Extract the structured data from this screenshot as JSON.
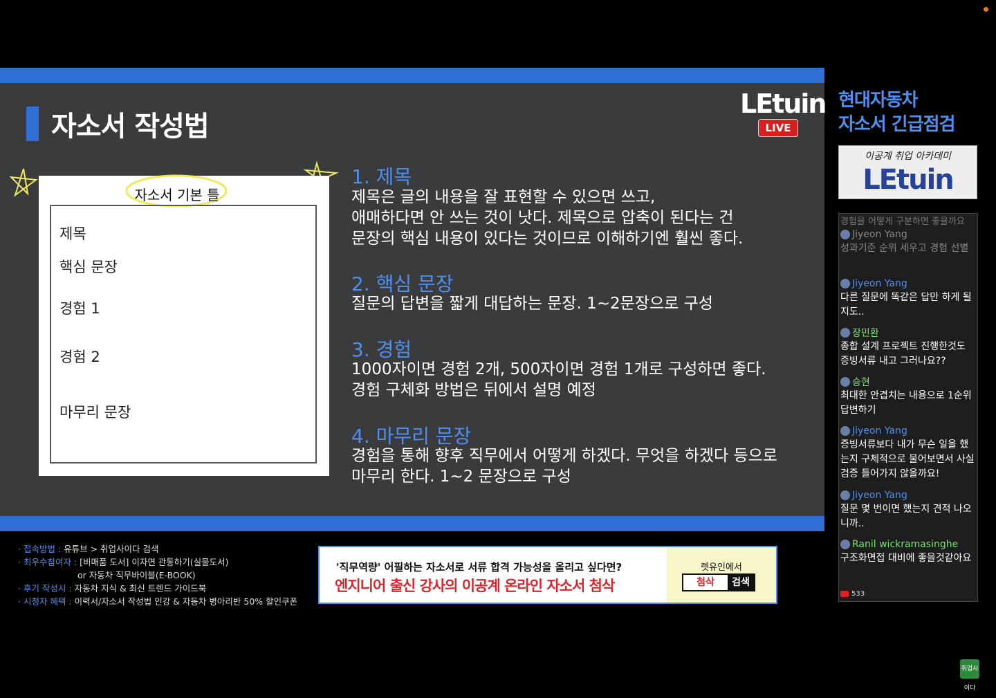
{
  "slide": {
    "title": "자소서 작성법",
    "logo": "LEtuin",
    "live": "LIVE",
    "card_header": "자소서 기본 틀",
    "card_items": [
      "제목",
      "핵심 문장",
      "경험 1",
      "경험 2",
      "마무리 문장"
    ],
    "sections": [
      {
        "head": "1. 제목",
        "lines": [
          "제목은 글의 내용을 잘 표현할 수 있으면 쓰고,",
          "애매하다면 안 쓰는 것이 낫다. 제목으로 압축이 된다는 건",
          "문장의 핵심 내용이 있다는 것이므로 이해하기엔 훨씬 좋다."
        ]
      },
      {
        "head": "2. 핵심 문장",
        "lines": [
          "질문의 답변을 짧게 대답하는 문장. 1~2문장으로 구성"
        ]
      },
      {
        "head": "3. 경험",
        "lines": [
          "1000자이면 경험 2개, 500자이면 경험 1개로 구성하면 좋다.",
          "경험 구체화 방법은 뒤에서 설명 예정"
        ]
      },
      {
        "head": "4. 마무리 문장",
        "lines": [
          "경험을 통해 향후 직무에서 어떻게 하겠다. 무엇을 하겠다 등으로",
          "마무리 한다. 1~2 문장으로 구성"
        ]
      }
    ]
  },
  "info": [
    {
      "label": "· 접속방법 :",
      "text": " 유튜브 > 취업사이다 검색"
    },
    {
      "label": "· 최우수참여자 :",
      "text": " [비매품 도서] 이자면 관통하기(실물도서)"
    },
    {
      "label": "",
      "text": "or 자동차 직무바이블(E-BOOK)"
    },
    {
      "label": "· 후기 작성시 :",
      "text": " 자동차 지식 & 최신 트렌드 가이드북"
    },
    {
      "label": "· 시청자 혜택 :",
      "text": " 이력서/자소서 작성법 인강 & 자동차 병아리반 50% 할인쿠폰"
    }
  ],
  "promo": {
    "sub": "'직무역량' 어필하는 자소서로 서류 합격 가능성을 올리고 싶다면?",
    "main": "엔지니어 출신 강사의 이공계 온라인 자소서 첨삭",
    "label": "렛유인에서",
    "search_value": "첨삭",
    "search_button": "검색"
  },
  "sidebar": {
    "title_line1": "현대자동차",
    "title_line2": "자소서 긴급점검",
    "logo_tag": "이공계 취업 아카데미",
    "logo": "LEtuin",
    "chat_top_faded": "경험을 어떻게 구분하면 좋을까요",
    "messages": [
      {
        "author": "Jiyeon Yang",
        "text": "성과기준 순위 세우고 경험 선별",
        "faded": true,
        "green": false
      },
      {
        "author": "Jiyeon Yang",
        "text": "다른 질문에 똑같은 답만 하게 될지도..",
        "faded": false,
        "green": false
      },
      {
        "author": "장민환",
        "text": "종합 설계 프로젝트 진행한것도 증빙서류 내고 그러나요??",
        "faded": false,
        "green": true
      },
      {
        "author": "승현",
        "text": "최대한 안겹치는 내용으로 1순위 답변하기",
        "faded": false,
        "green": true
      },
      {
        "author": "Jiyeon Yang",
        "text": "증빙서류보다 내가 무슨 일을 했는지 구체적으로 물어보면서 사실검증 들어가지 않을까요!",
        "faded": false,
        "green": false
      },
      {
        "author": "Jiyeon Yang",
        "text": "질문 몇 번이면 했는지 견적 나오니까..",
        "faded": false,
        "green": false
      },
      {
        "author": "Ranil wickramasinghe",
        "text": "구조화면접 대비에 좋을것같아요",
        "faded": false,
        "green": true
      }
    ],
    "viewers": "533"
  },
  "corner_badge": "취업사이다"
}
